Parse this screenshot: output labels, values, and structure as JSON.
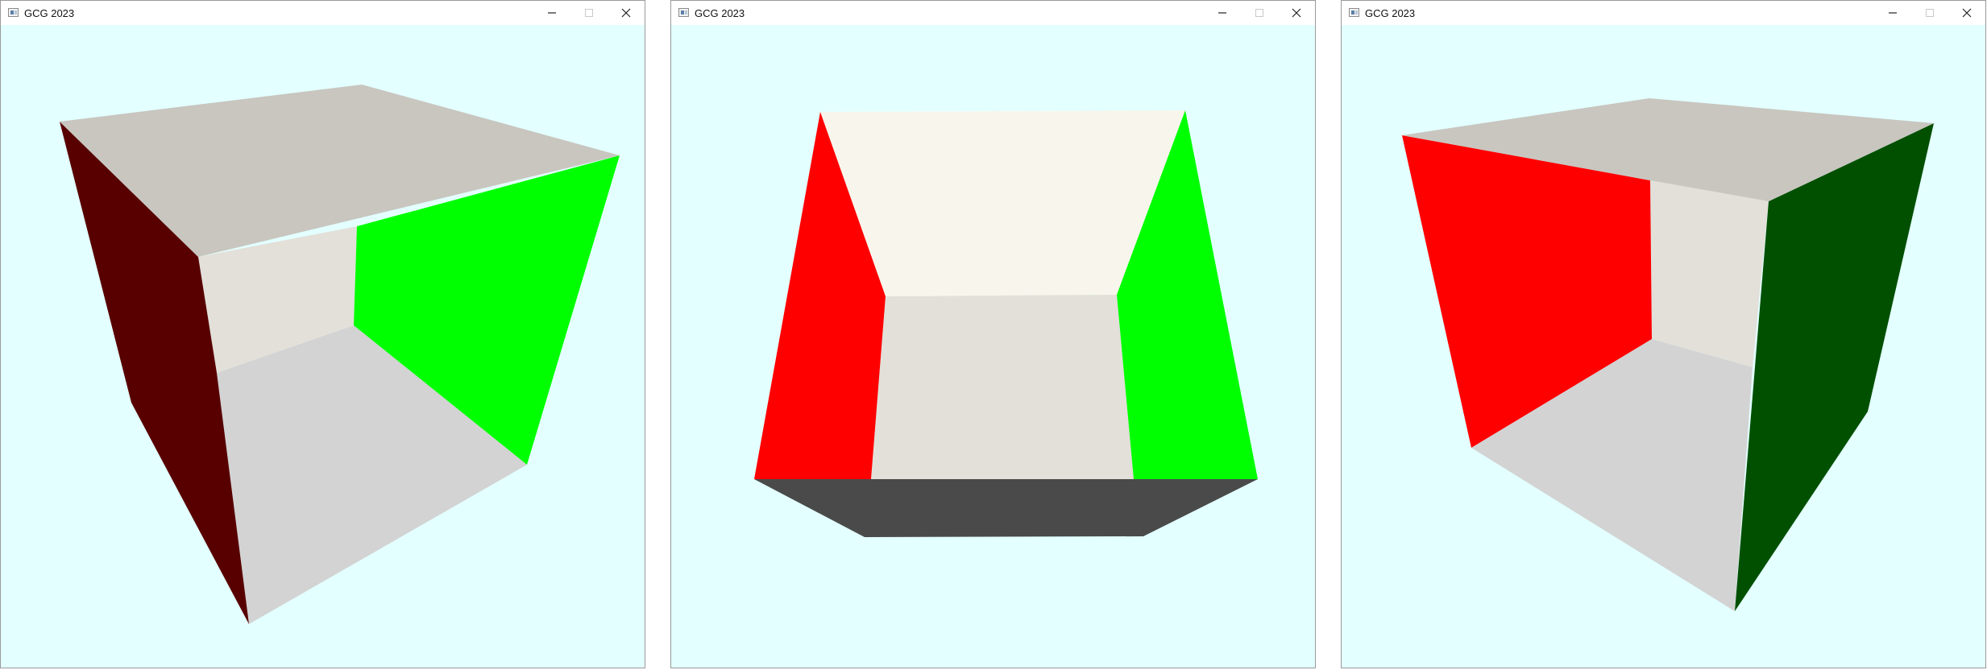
{
  "windows": [
    {
      "title": "GCG 2023"
    },
    {
      "title": "GCG 2023"
    },
    {
      "title": "GCG 2023"
    }
  ],
  "colors": {
    "background": "#e3ffff",
    "red": "#ff0000",
    "green": "#00ff00",
    "dark_red": "#580000",
    "dark_green": "#005000",
    "ceiling": "#c8c6bf",
    "back_wall": "#e2e0d9",
    "floor": "#d3d3d3",
    "ceiling_lit": "#f8f6ec",
    "underside": "#4a4a4a"
  },
  "icons": {
    "app": "app-icon",
    "minimize": "minimize-icon",
    "maximize": "maximize-icon",
    "close": "close-icon"
  }
}
